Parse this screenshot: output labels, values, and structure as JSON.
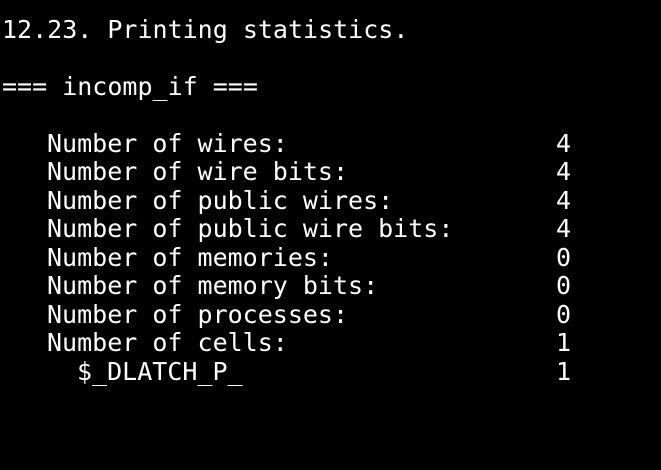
{
  "terminal": {
    "background": "#000000",
    "foreground": "#ffffff",
    "section_title": "12.23. Printing statistics.",
    "module_header": "=== incomp_if ===",
    "stats": [
      {
        "label": "Number of wires:",
        "value": "4"
      },
      {
        "label": "Number of wire bits:",
        "value": "4"
      },
      {
        "label": "Number of public wires:",
        "value": "4"
      },
      {
        "label": "Number of public wire bits:",
        "value": "4"
      },
      {
        "label": "Number of memories:",
        "value": "0"
      },
      {
        "label": "Number of memory bits:",
        "value": "0"
      },
      {
        "label": "Number of processes:",
        "value": "0"
      },
      {
        "label": "Number of cells:",
        "value": "1"
      }
    ],
    "cell_types": [
      {
        "label": "$_DLATCH_P_",
        "value": "1"
      }
    ]
  }
}
